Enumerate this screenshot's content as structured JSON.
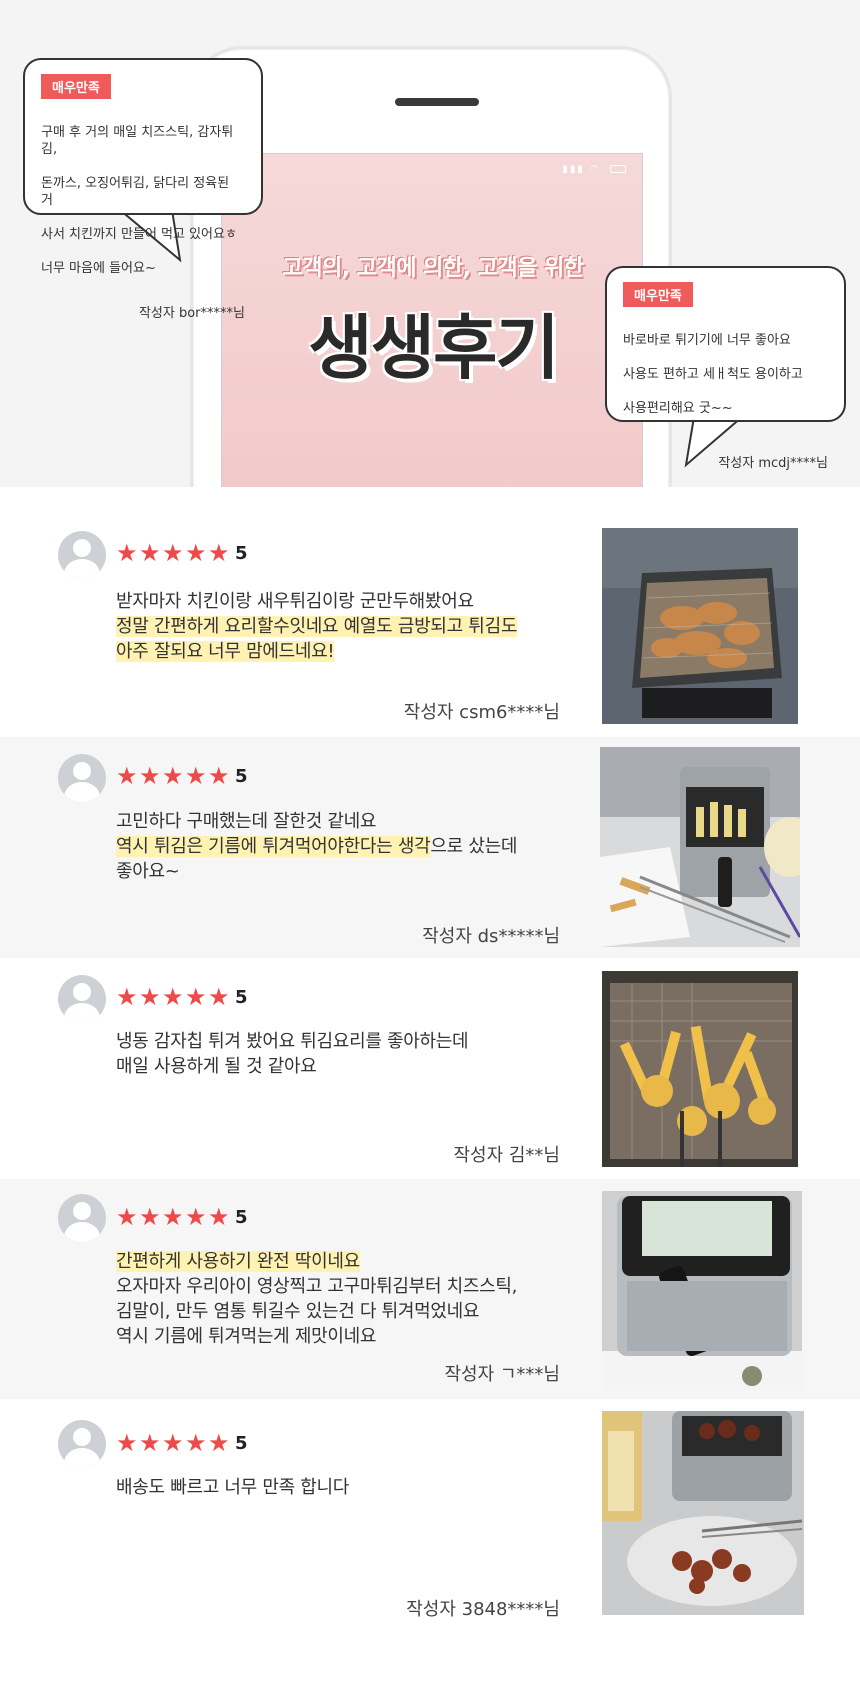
{
  "hero": {
    "subtitle": "고객의, 고객에 의한, 고객을 위한",
    "title": "생생후기",
    "bubbles": [
      {
        "badge": "매우만족",
        "lines": [
          "구매 후 거의 매일 치즈스틱, 감자튀김,",
          "돈까스, 오징어튀김, 닭다리 정육된 거",
          "사서 치킨까지 만들어 먹고 있어요ㅎ",
          "너무 마음에 들어요~"
        ],
        "author": "작성자 bor*****님"
      },
      {
        "badge": "매우만족",
        "lines": [
          "바로바로 튀기기에 너무 좋아요",
          "사용도 편하고 세ㅐ척도 용이하고",
          "사용편리해요 굿~~"
        ],
        "author": "작성자 mcdj****님"
      }
    ]
  },
  "reviews": [
    {
      "rating": "5",
      "lines": [
        {
          "text": "받자마자 치킨이랑 새우튀김이랑 군만두해봤어요",
          "highlight": false
        },
        {
          "text": "정말 간편하게 요리할수잇네요 예열도 금방되고 튀김도",
          "highlight": true
        },
        {
          "text": "아주 잘되요 너무 맘에드네요!",
          "highlight": true
        }
      ],
      "author": "작성자 csm6****님",
      "photo_icon": "fried-chicken-basket-photo"
    },
    {
      "rating": "5",
      "lines": [
        {
          "text": "고민하다 구매했는데 잘한것 같네요",
          "highlight": false
        },
        {
          "text": "역시 튀김은 기름에 튀겨먹어야한다는 생각",
          "highlight": true,
          "tail": "으로 샀는데"
        },
        {
          "text": "좋아요~",
          "highlight": false
        }
      ],
      "author": "작성자 ds*****님",
      "photo_icon": "fryer-with-tempura-photo"
    },
    {
      "rating": "5",
      "lines": [
        {
          "text": "냉동 감자칩 튀겨 봤어요 튀김요리를 좋아하는데",
          "highlight": false
        },
        {
          "text": "매일 사용하게 될 것 같아요",
          "highlight": false
        }
      ],
      "author": "작성자 김**님",
      "photo_icon": "french-fries-basket-photo"
    },
    {
      "rating": "5",
      "lines": [
        {
          "text": "간편하게 사용하기 완전 딱이네요",
          "highlight": true
        },
        {
          "text": "오자마자 우리아이 영상찍고 고구마튀김부터 치즈스틱,",
          "highlight": false
        },
        {
          "text": "김말이, 만두 염통 튀길수 있는건 다 튀겨먹었네요",
          "highlight": false
        },
        {
          "text": "역시 기름에 튀겨먹는게 제맛이네요",
          "highlight": false
        }
      ],
      "author": "작성자 ㄱ***님",
      "photo_icon": "closed-fryer-photo"
    },
    {
      "rating": "5",
      "lines": [
        {
          "text": "배송도 빠르고 너무 만족 합니다",
          "highlight": false
        }
      ],
      "author": "작성자 3848****님",
      "photo_icon": "fryer-with-chicken-photo"
    }
  ],
  "colors": {
    "accent": "#ef5a5a",
    "star": "#ee4a4a",
    "highlight": "#fff2b3",
    "stripe": "#f6f6f6"
  }
}
